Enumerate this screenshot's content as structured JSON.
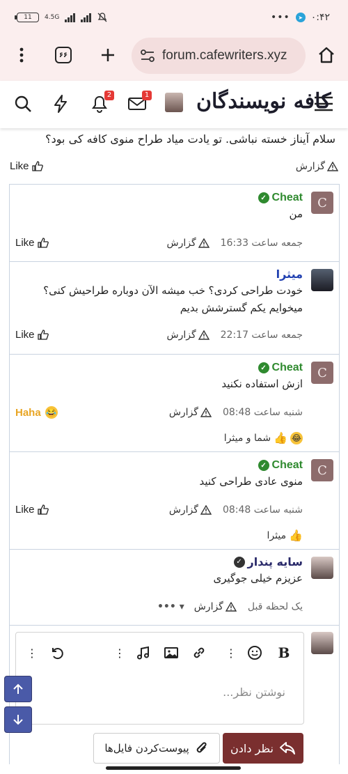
{
  "status": {
    "time": "۰:۴۲",
    "battery": "11",
    "network": "4.5G"
  },
  "browser": {
    "url": "forum.cafewriters.xyz",
    "tab_count": "۶۶"
  },
  "header": {
    "logo_text": "کافه نویسندگان",
    "notifications_badge": "2",
    "messages_badge": "1"
  },
  "intro": {
    "text": "سلام آیناز خسته نباشی. تو یادت میاد طراح منوی کافه کی بود؟",
    "like_label": "Like",
    "report_label": "گزارش"
  },
  "posts": [
    {
      "author": "Cheat",
      "avatar_letter": "C",
      "text": "من",
      "time": "جمعه ساعت 16:33",
      "report_label": "گزارش",
      "reaction_label": "Like",
      "reactors": ""
    },
    {
      "author": "میثرا",
      "avatar_letter": "",
      "text": "خودت طراحی کردی؟ خب میشه الآن دوباره طراحیش کنی؟ میخوایم یکم گسترشش بدیم",
      "time": "جمعه ساعت 22:17",
      "report_label": "گزارش",
      "reaction_label": "Like",
      "reactors": ""
    },
    {
      "author": "Cheat",
      "avatar_letter": "C",
      "text": "ازش استفاده نکنید",
      "time": "شنبه ساعت 08:48",
      "report_label": "گزارش",
      "reaction_label": "Haha",
      "reactors": "شما و میثرا"
    },
    {
      "author": "Cheat",
      "avatar_letter": "C",
      "text": "منوی عادی طراحی کنید",
      "time": "شنبه ساعت 08:48",
      "report_label": "گزارش",
      "reaction_label": "Like",
      "reactors": "میثرا"
    },
    {
      "author": "سایه پندار",
      "avatar_letter": "",
      "text": "عزیزم خیلی جوگیری",
      "time": "یک لحظه قبل",
      "report_label": "گزارش",
      "reaction_label": "",
      "reactors": ""
    }
  ],
  "editor": {
    "placeholder": "نوشتن نظر...",
    "reply_button": "نظر دادن",
    "attach_button": "پیوست‌کردن فایل‌ها"
  },
  "colors": {
    "accent": "#7a2f2f",
    "green_user": "#2f8a2f",
    "blue_user": "#1f3fb0",
    "scroll_button": "#4a5aa8"
  }
}
